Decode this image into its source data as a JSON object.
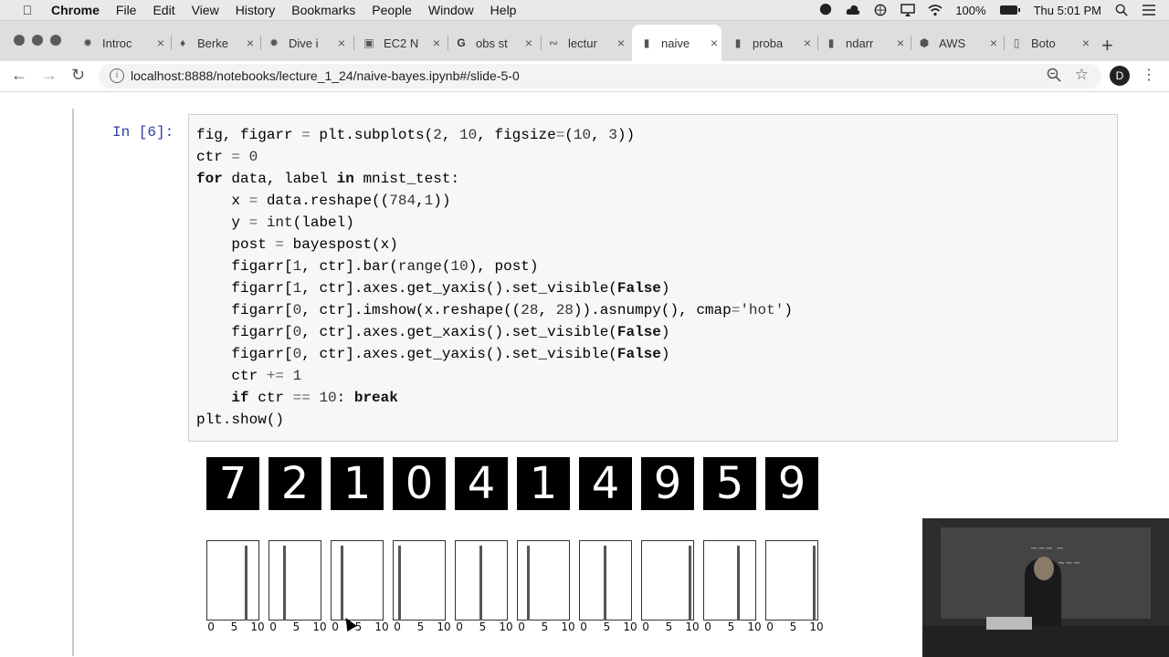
{
  "menubar": {
    "app": "Chrome",
    "items": [
      "File",
      "Edit",
      "View",
      "History",
      "Bookmarks",
      "People",
      "Window",
      "Help"
    ],
    "battery": "100%",
    "clock": "Thu 5:01 PM"
  },
  "tabs": [
    {
      "title": "Introc",
      "icon": "compass-icon"
    },
    {
      "title": "Berke",
      "icon": "berkeley-icon"
    },
    {
      "title": "Dive i",
      "icon": "compass-icon"
    },
    {
      "title": "EC2 N",
      "icon": "ec2-icon"
    },
    {
      "title": "obs st",
      "icon": "google-icon"
    },
    {
      "title": "lectur",
      "icon": "jupyter-icon"
    },
    {
      "title": "naive",
      "icon": "notebook-icon",
      "active": true
    },
    {
      "title": "proba",
      "icon": "notebook-icon"
    },
    {
      "title": "ndarr",
      "icon": "notebook-icon"
    },
    {
      "title": "AWS",
      "icon": "aws-icon"
    },
    {
      "title": "Boto",
      "icon": "document-icon"
    }
  ],
  "address": {
    "url": "localhost:8888/notebooks/lecture_1_24/naive-bayes.ipynb#/slide-5-0",
    "profile_initial": "D"
  },
  "cell": {
    "prompt": "In [6]:",
    "code": [
      "fig, figarr = plt.subplots(2, 10, figsize=(10, 3))",
      "ctr = 0",
      "for data, label in mnist_test:",
      "    x = data.reshape((784,1))",
      "    y = int(label)",
      "    post = bayespost(x)",
      "    figarr[1, ctr].bar(range(10), post)",
      "    figarr[1, ctr].axes.get_yaxis().set_visible(False)",
      "    figarr[0, ctr].imshow(x.reshape((28, 28)).asnumpy(), cmap='hot')",
      "    figarr[0, ctr].axes.get_xaxis().set_visible(False)",
      "    figarr[0, ctr].axes.get_yaxis().set_visible(False)",
      "    ctr += 1",
      "    if ctr == 10: break",
      "plt.show()"
    ]
  },
  "output": {
    "digits": [
      7,
      2,
      1,
      0,
      4,
      1,
      4,
      9,
      5,
      9
    ],
    "predicted_class": [
      7,
      2,
      1,
      0,
      4,
      1,
      4,
      9,
      6,
      9
    ],
    "tick_labels": [
      "0",
      "5",
      "10"
    ],
    "digit_color": "#ffffff",
    "image_bg": "#000000",
    "bar_color": "#555555"
  }
}
